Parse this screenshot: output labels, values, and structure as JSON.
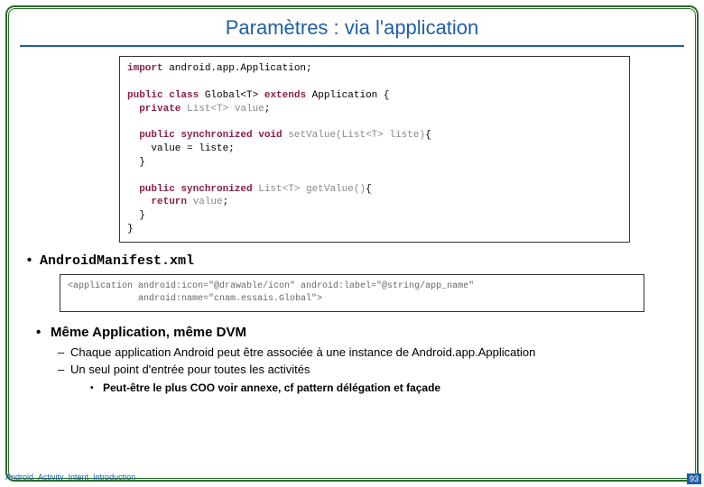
{
  "title": "Paramètres : via l'application",
  "code1_kw1": "import",
  "code1_l1b": " android.app.Application;",
  "code1_blank1": " ",
  "code1_kw2a": "public class",
  "code1_l2b": " Global<T> ",
  "code1_kw2c": "extends",
  "code1_l2d": " Application {",
  "code1_kw3": "  private",
  "code1_l3b": " ",
  "code1_dim3": "List<T> value",
  "code1_l3d": ";",
  "code1_blank2": " ",
  "code1_kw4": "  public synchronized void",
  "code1_l4b": " ",
  "code1_dim4": "setValue(List<T> liste)",
  "code1_l4d": "{",
  "code1_l5": "    value = liste;",
  "code1_l6": "  }",
  "code1_blank3": " ",
  "code1_kw7": "  public synchronized",
  "code1_l7b": " ",
  "code1_dim7": "List<T> getValue()",
  "code1_l7d": "{",
  "code1_kw8": "    return",
  "code1_l8b": " ",
  "code1_dim8": "value",
  "code1_l8d": ";",
  "code1_l9": "  }",
  "code1_l10": "}",
  "bullet1": "AndroidManifest.xml",
  "code2_l1": "<application android:icon=\"@drawable/icon\" android:label=\"@string/app_name\"",
  "code2_l2": "             android:name=\"cnam.essais.Global\">",
  "bullet2": "Même Application, même DVM",
  "sub1": "Chaque application Android peut être associée à une instance de Android.app.Application",
  "sub2": "Un seul point d'entrée pour toutes les activités",
  "sub3": "Peut-être le plus COO voir annexe, cf pattern délégation et façade",
  "footer": "Android_Activity_Intent_Introduction",
  "pagenum": "93"
}
